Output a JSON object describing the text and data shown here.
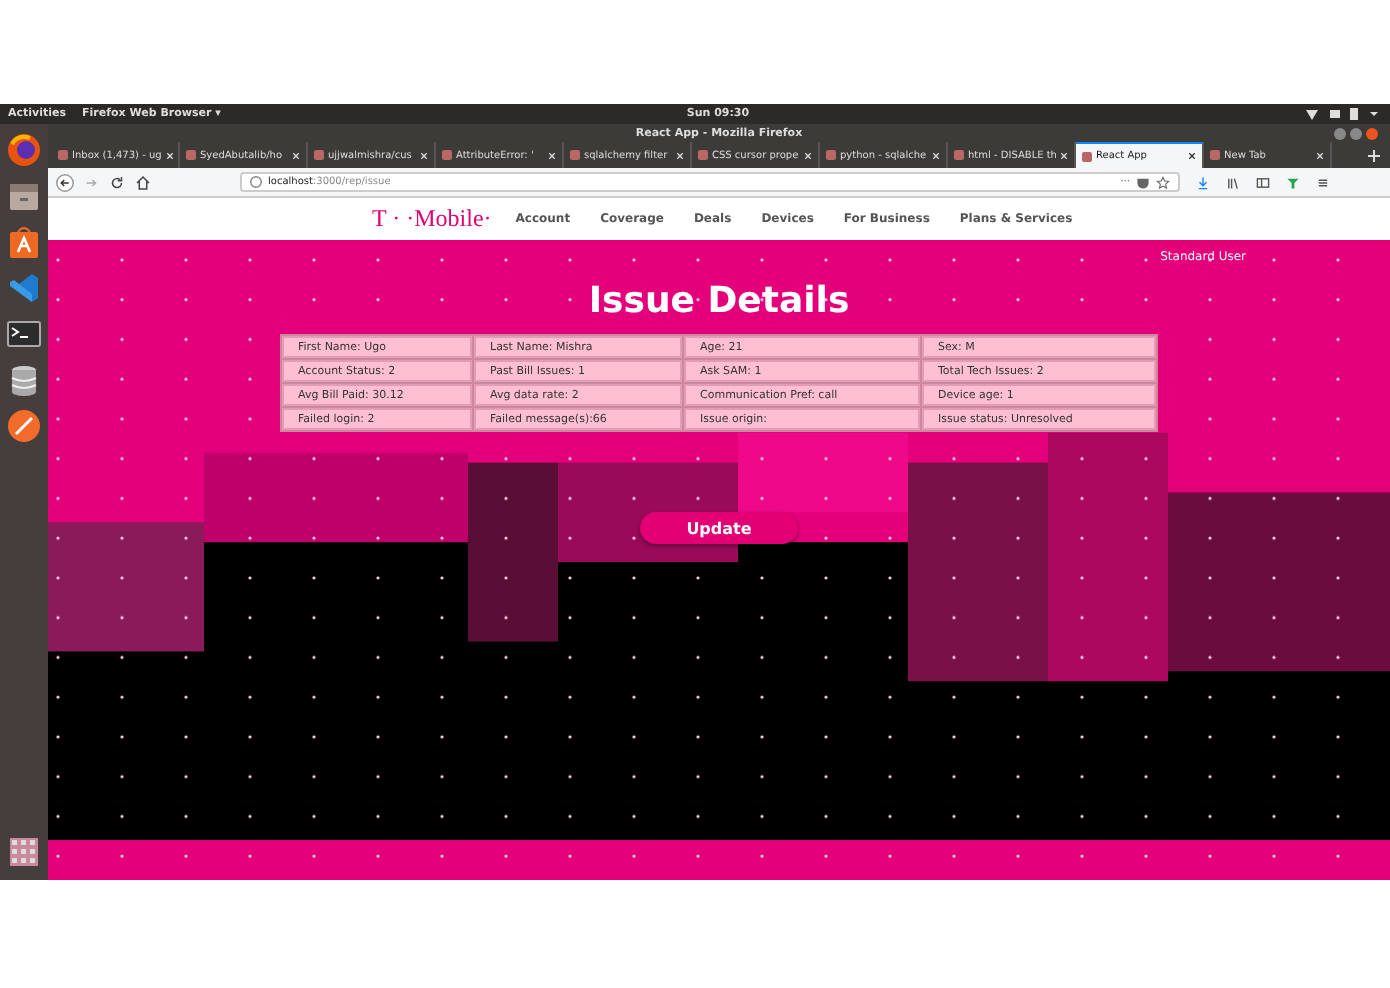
{
  "topbar": {
    "activities": "Activities",
    "app_menu": "Firefox Web Browser ▾",
    "clock": "Sun 09:30"
  },
  "window": {
    "title": "React App - Mozilla Firefox"
  },
  "tabs": [
    {
      "label": "Inbox (1,473) - ug",
      "selected": false
    },
    {
      "label": "SyedAbutalib/ho",
      "selected": false
    },
    {
      "label": "ujjwalmishra/cus",
      "selected": false
    },
    {
      "label": "AttributeError: '",
      "selected": false
    },
    {
      "label": "sqlalchemy filter",
      "selected": false
    },
    {
      "label": "CSS cursor prope",
      "selected": false
    },
    {
      "label": "python - sqlalche",
      "selected": false
    },
    {
      "label": "html - DISABLE th",
      "selected": false
    },
    {
      "label": "React App",
      "selected": true
    },
    {
      "label": "New Tab",
      "selected": false
    }
  ],
  "address_bar": {
    "host": "localhost",
    "path": ":3000/rep/issue",
    "menu": "···"
  },
  "site": {
    "logo": "T · ·Mobile·",
    "nav": [
      "Account",
      "Coverage",
      "Deals",
      "Devices",
      "For Business",
      "Plans & Services"
    ],
    "user": "Standard User",
    "title": "Issue Details",
    "details": [
      [
        "First Name: Ugo",
        "Last Name: Mishra",
        "Age: 21",
        "Sex: M"
      ],
      [
        "Account Status: 2",
        "Past Bill Issues: 1",
        "Ask SAM: 1",
        "Total Tech Issues: 2"
      ],
      [
        "Avg Bill Paid: 30.12",
        "Avg data rate: 2",
        "Communication Pref: call",
        "Device age: 1"
      ],
      [
        "Failed login: 2",
        "Failed message(s):66",
        "Issue origin:",
        "Issue status: Unresolved"
      ]
    ],
    "button": "Update"
  }
}
